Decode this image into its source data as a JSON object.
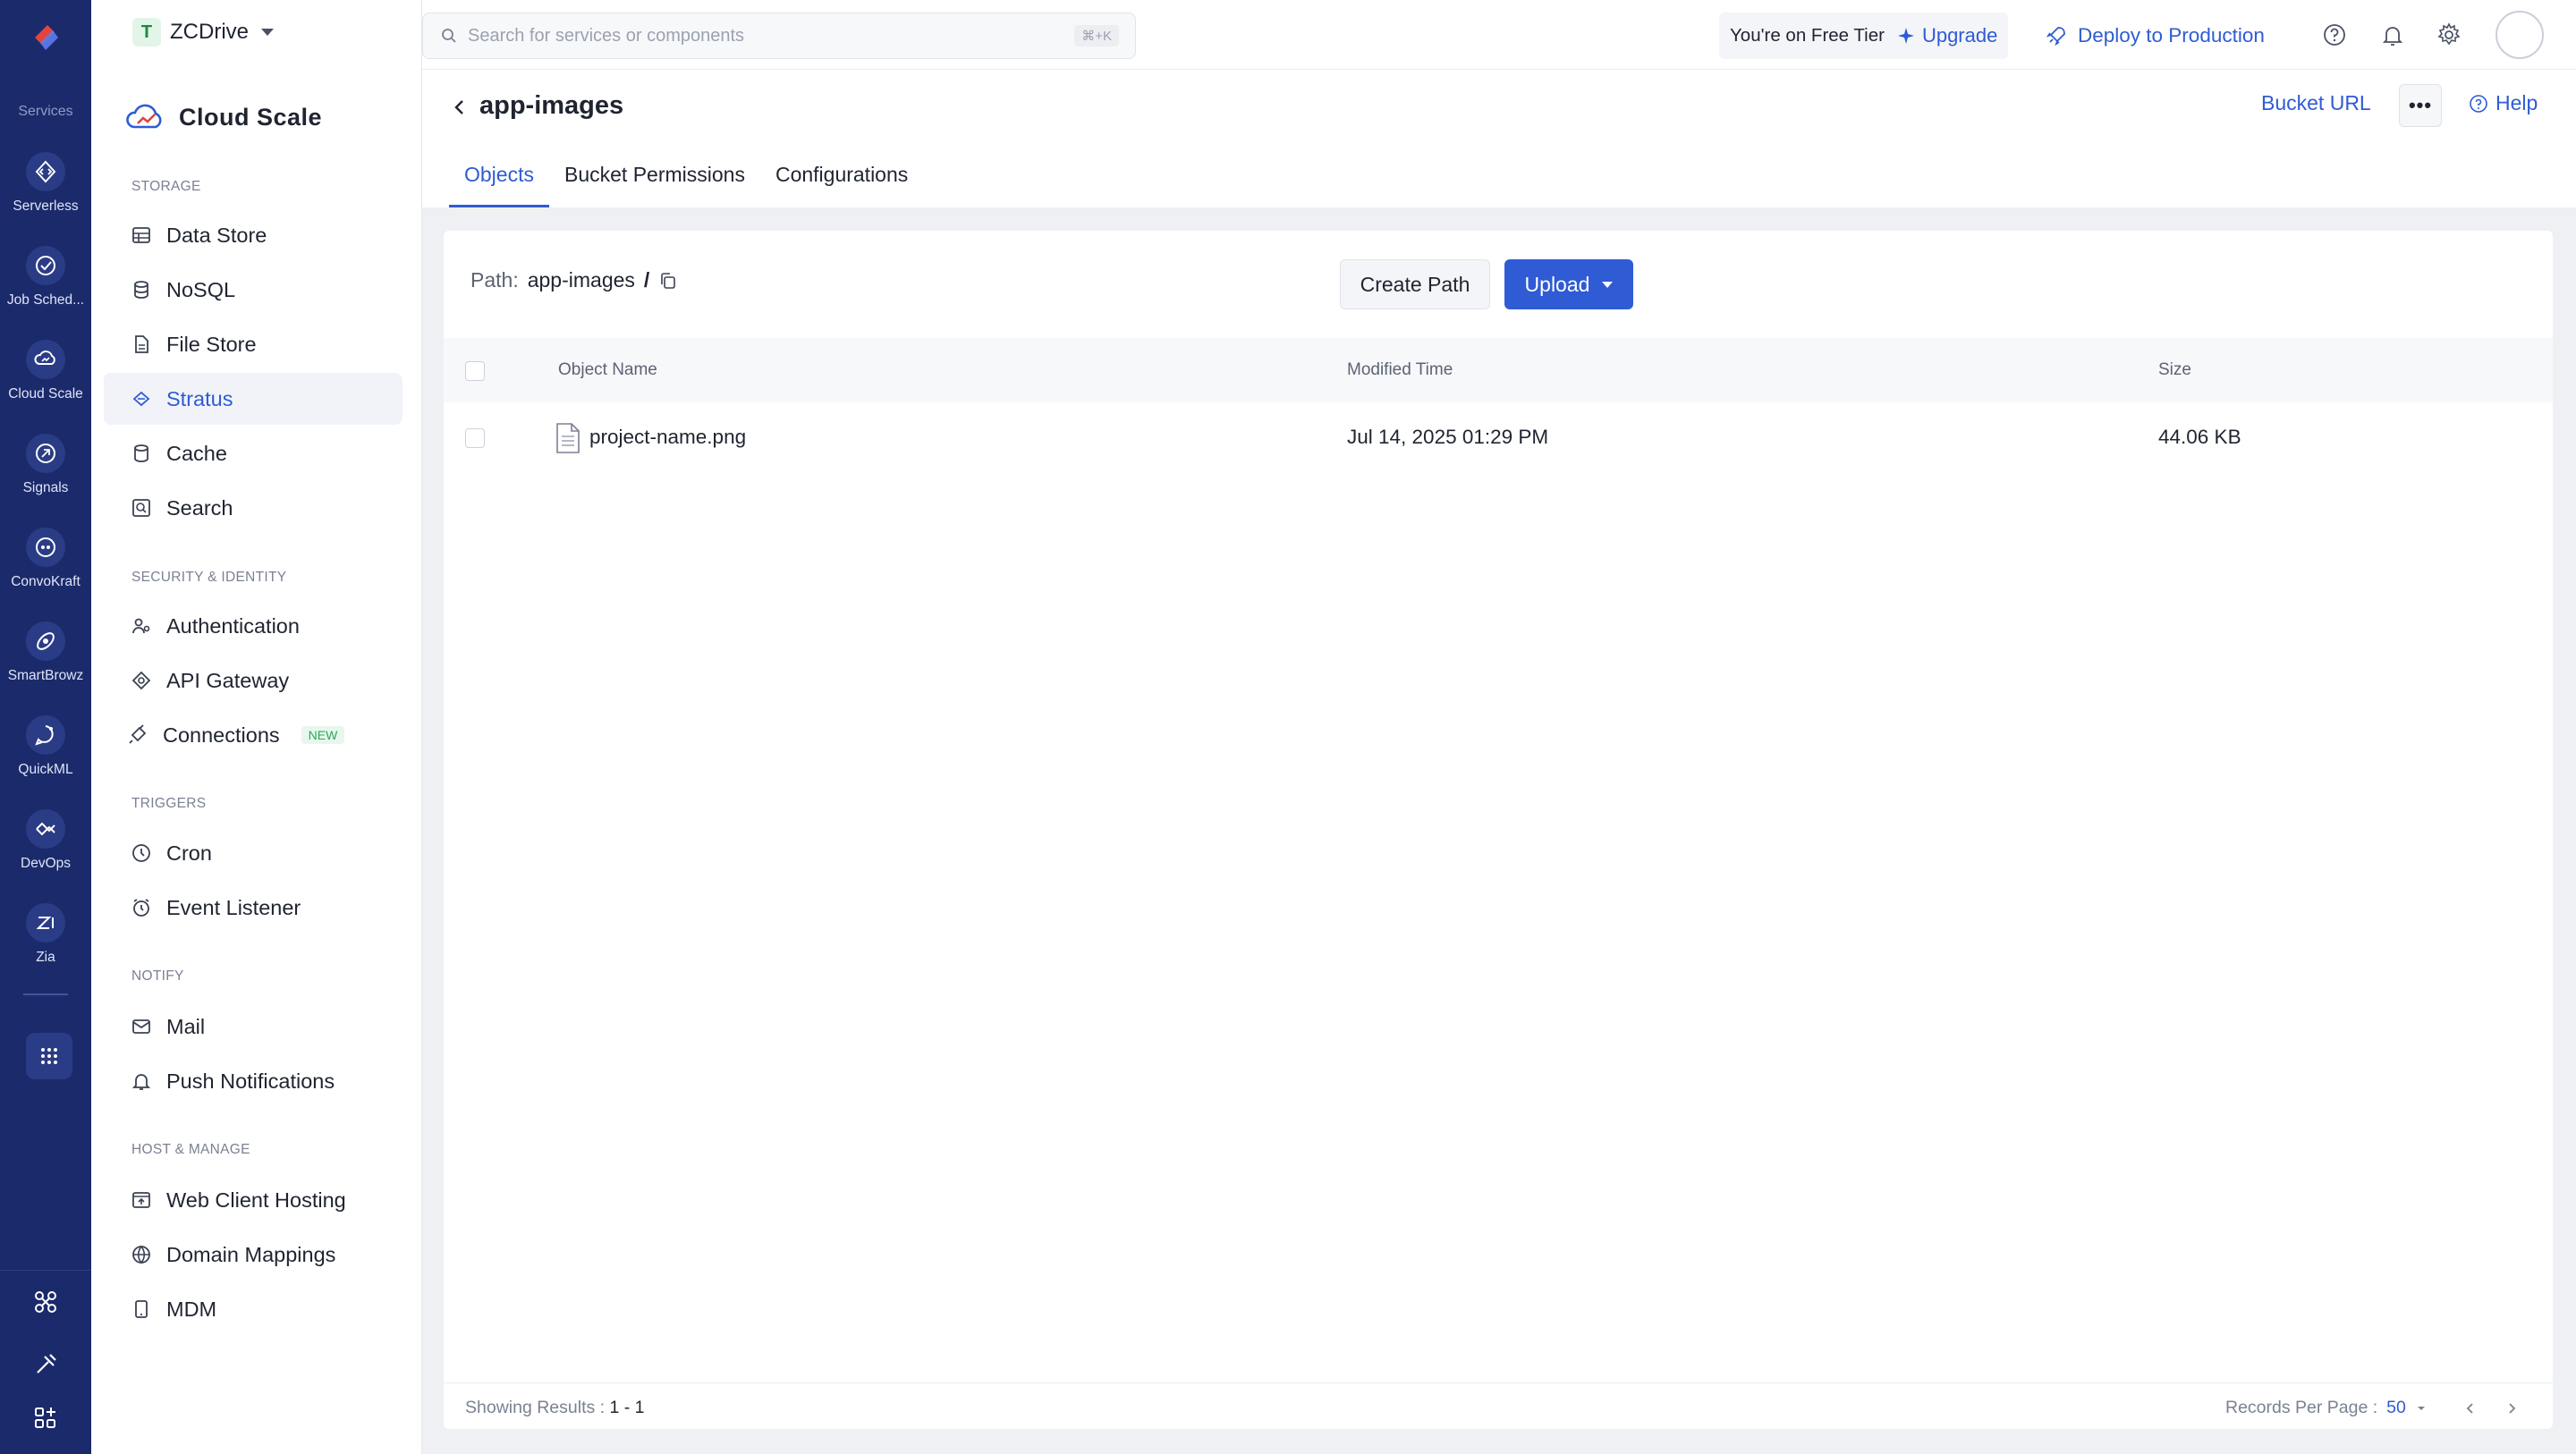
{
  "rail": {
    "services_label": "Services",
    "items": [
      {
        "label": "Serverless",
        "icon": "serverless-icon"
      },
      {
        "label": "Job Sched...",
        "icon": "job-scheduling-icon"
      },
      {
        "label": "Cloud Scale",
        "icon": "cloud-scale-icon"
      },
      {
        "label": "Signals",
        "icon": "signals-icon"
      },
      {
        "label": "ConvoKraft",
        "icon": "convokraft-icon"
      },
      {
        "label": "SmartBrowz",
        "icon": "smartbrowz-icon"
      },
      {
        "label": "QuickML",
        "icon": "quickml-icon"
      },
      {
        "label": "DevOps",
        "icon": "devops-icon"
      },
      {
        "label": "Zia",
        "icon": "zia-icon"
      }
    ]
  },
  "workspace": {
    "initial": "T",
    "name": "ZCDrive"
  },
  "product": {
    "name": "Cloud Scale"
  },
  "sidebar": {
    "sections": [
      {
        "title": "STORAGE",
        "items": [
          "Data Store",
          "NoSQL",
          "File Store",
          "Stratus",
          "Cache",
          "Search"
        ]
      },
      {
        "title": "SECURITY & IDENTITY",
        "items": [
          "Authentication",
          "API Gateway",
          "Connections"
        ]
      },
      {
        "title": "TRIGGERS",
        "items": [
          "Cron",
          "Event Listener"
        ]
      },
      {
        "title": "NOTIFY",
        "items": [
          "Mail",
          "Push Notifications"
        ]
      },
      {
        "title": "HOST & MANAGE",
        "items": [
          "Web Client Hosting",
          "Domain Mappings",
          "MDM"
        ]
      }
    ],
    "active": "Stratus",
    "new_badge": "NEW"
  },
  "topbar": {
    "search_placeholder": "Search for services or components",
    "search_shortcut": "⌘+K",
    "tier_text": "You're on Free Tier",
    "upgrade_label": "Upgrade",
    "deploy_label": "Deploy to Production"
  },
  "page": {
    "title": "app-images",
    "bucket_url_label": "Bucket URL",
    "more_label": "•••",
    "help_label": "Help",
    "tabs": [
      "Objects",
      "Bucket Permissions",
      "Configurations"
    ],
    "active_tab": "Objects"
  },
  "objects": {
    "path_label": "Path:",
    "path_value": "app-images",
    "path_sep": "/",
    "create_path_label": "Create Path",
    "upload_label": "Upload",
    "columns": [
      "Object Name",
      "Modified Time",
      "Size"
    ],
    "rows": [
      {
        "name": "project-name.png",
        "modified": "Jul 14, 2025 01:29 PM",
        "size": "44.06 KB"
      }
    ],
    "footer": {
      "showing_label": "Showing Results :",
      "showing_value": "1 - 1",
      "per_page_label": "Records Per Page :",
      "per_page_value": "50"
    }
  },
  "colors": {
    "rail": "#1b2a6b",
    "accent": "#2f5bd4",
    "new_badge": "#2ea55a"
  }
}
